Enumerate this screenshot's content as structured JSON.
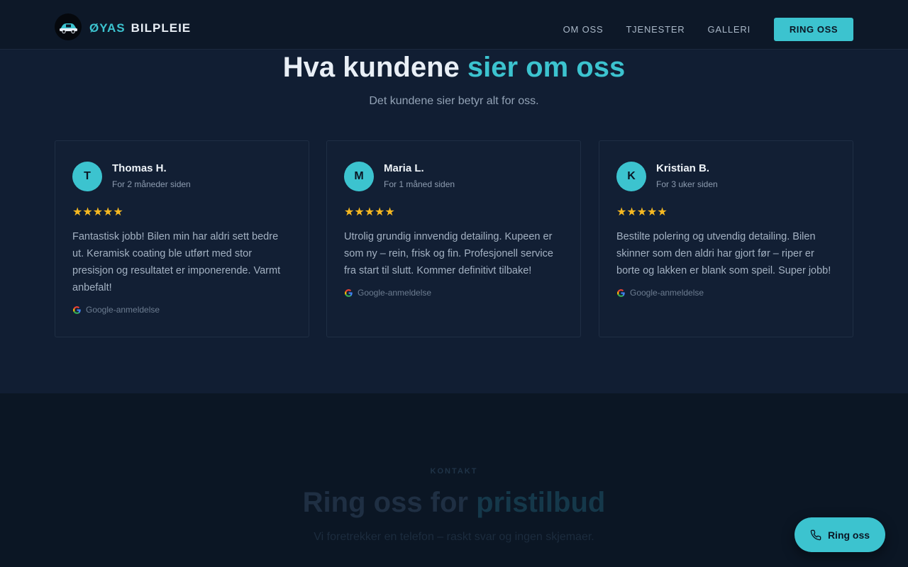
{
  "header": {
    "brand_part1": "ØYAS",
    "brand_part2": "BILPLEIE",
    "nav": [
      "OM OSS",
      "TJENESTER",
      "GALLERI"
    ],
    "cta": "RING OSS"
  },
  "reviews": {
    "title_part1": "Hva kundene",
    "title_accent": "sier om oss",
    "subtitle": "Det kundene sier betyr alt for oss.",
    "items": [
      {
        "initial": "T",
        "name": "Thomas H.",
        "time": "For 2 måneder siden",
        "stars": "★★★★★",
        "rating": 5,
        "text": "Fantastisk jobb! Bilen min har aldri sett bedre ut. Keramisk coating ble utført med stor presisjon og resultatet er imponerende. Varmt anbefalt!",
        "source": "Google-anmeldelse"
      },
      {
        "initial": "M",
        "name": "Maria L.",
        "time": "For 1 måned siden",
        "stars": "★★★★★",
        "rating": 5,
        "text": "Utrolig grundig innvendig detailing. Kupeen er som ny – rein, frisk og fin. Profesjonell service fra start til slutt. Kommer definitivt tilbake!",
        "source": "Google-anmeldelse"
      },
      {
        "initial": "K",
        "name": "Kristian B.",
        "time": "For 3 uker siden",
        "stars": "★★★★★",
        "rating": 5,
        "text": "Bestilte polering og utvendig detailing. Bilen skinner som den aldri har gjort før – riper er borte og lakken er blank som speil. Super jobb!",
        "source": "Google-anmeldelse"
      }
    ]
  },
  "contact": {
    "kicker": "KONTAKT",
    "title_part1": "Ring oss for",
    "title_accent": "pristilbud",
    "subtitle": "Vi foretrekker en telefon – raskt svar og ingen skjemaer."
  },
  "floating_button": {
    "label": "Ring oss",
    "icon": "phone-icon"
  },
  "colors": {
    "accent": "#3cc3cf",
    "background": "#111e33",
    "star": "#f5b821"
  }
}
